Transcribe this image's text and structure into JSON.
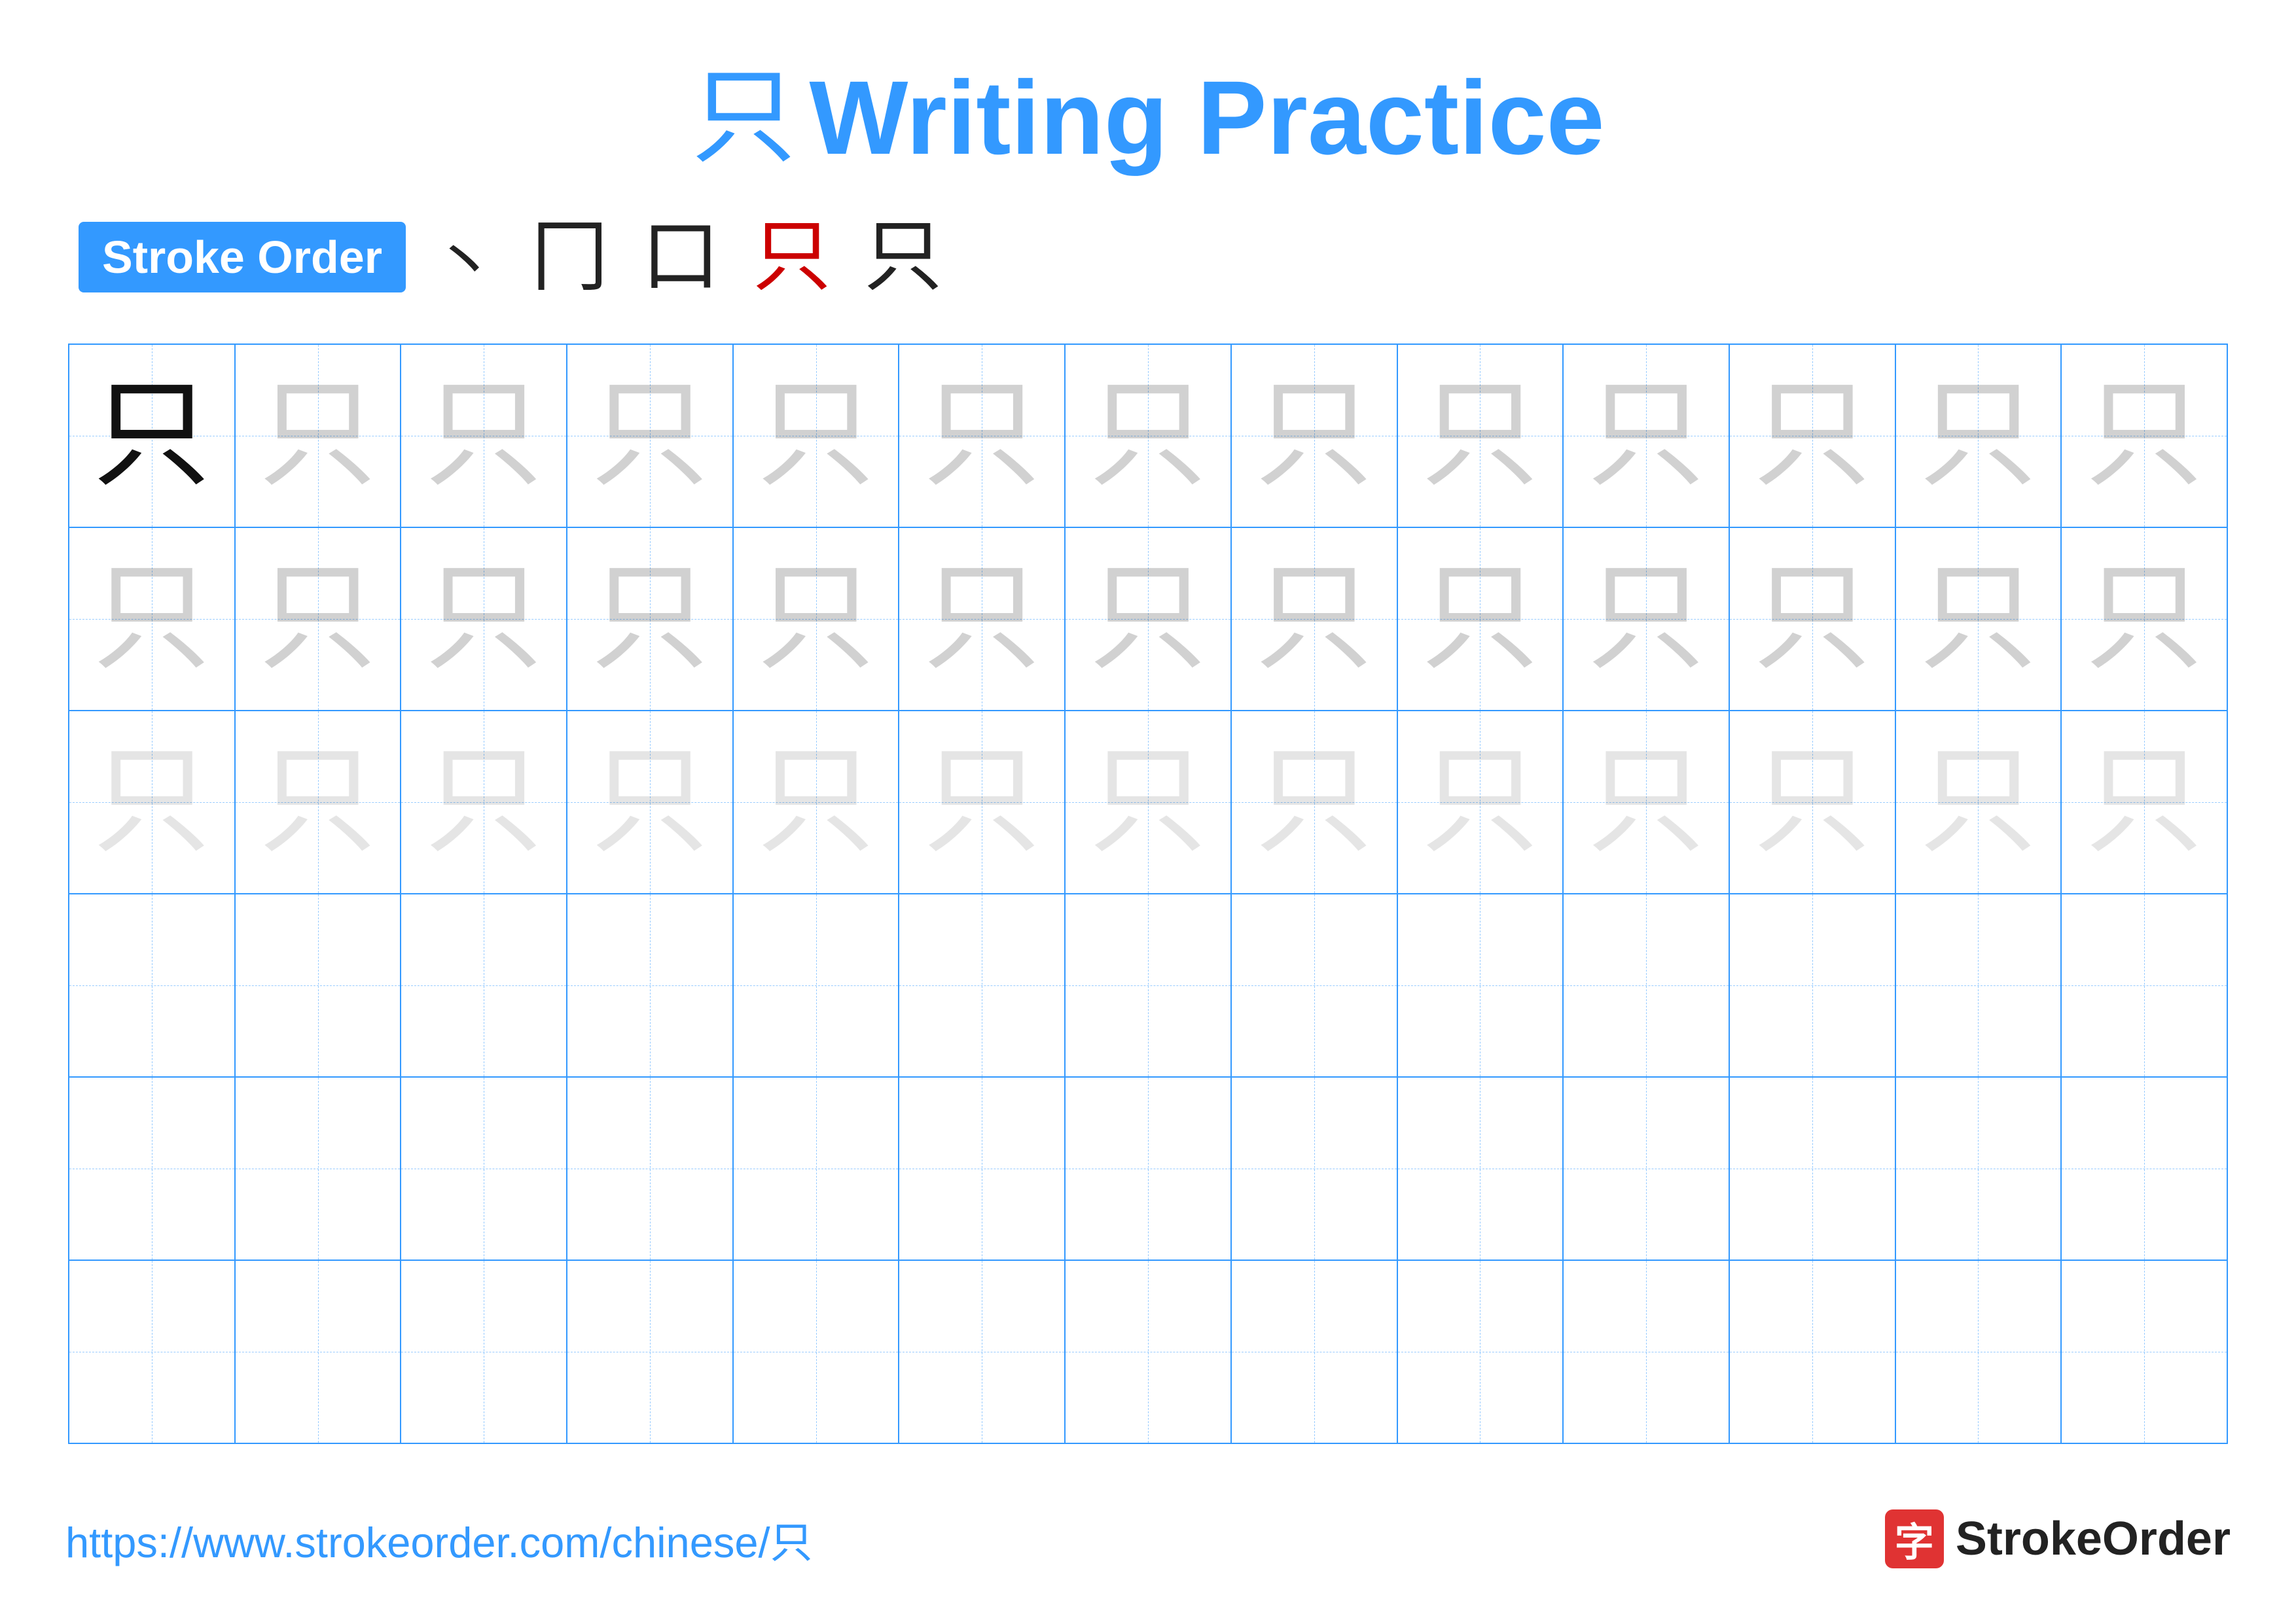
{
  "title": {
    "character": "只",
    "text": "Writing Practice"
  },
  "stroke_order": {
    "badge_label": "Stroke Order",
    "steps": [
      "丶",
      "冂",
      "口",
      "只",
      "只"
    ]
  },
  "grid": {
    "rows": 6,
    "cols": 13,
    "char": "只",
    "row1_solid_count": 1,
    "row1_faded_dark_count": 12,
    "row2_faded_dark_count": 13,
    "row3_faded_light_count": 13,
    "row4_empty": true,
    "row5_empty": true,
    "row6_empty": true
  },
  "footer": {
    "link_text": "https://www.strokeorder.com/chinese/只",
    "logo_icon": "字",
    "logo_text": "StrokeOrder"
  }
}
